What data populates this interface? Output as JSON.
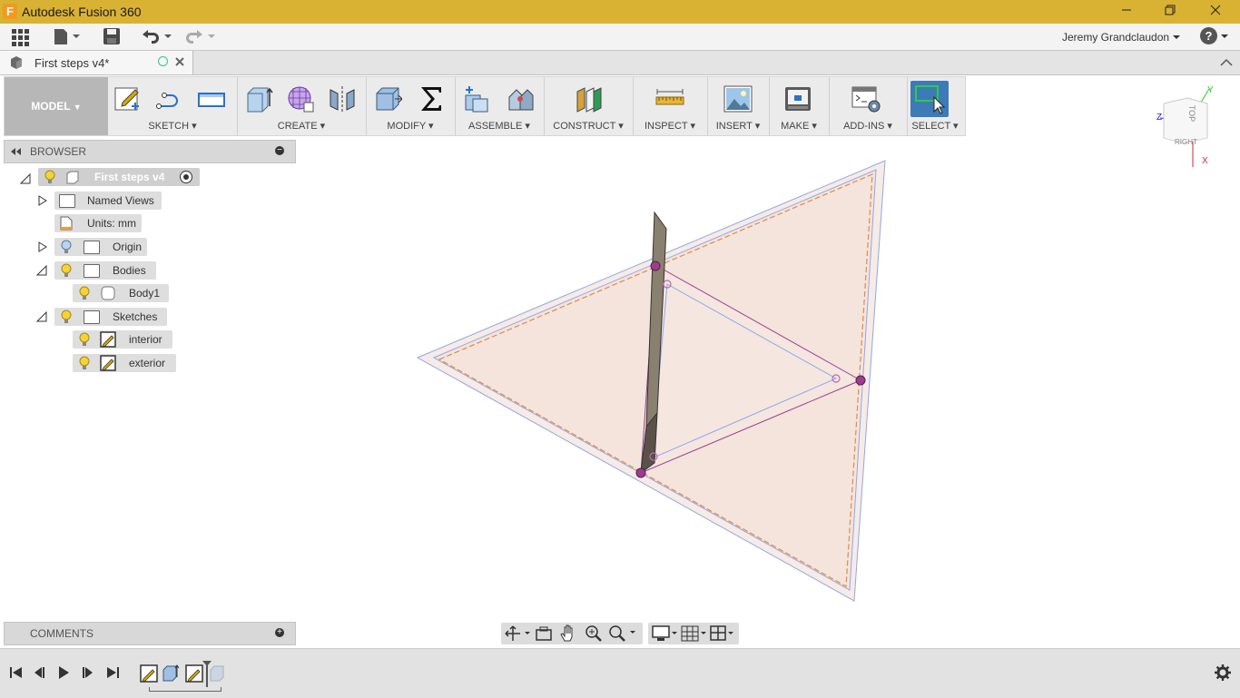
{
  "titlebar": {
    "app_title": "Autodesk Fusion 360",
    "app_icon_letter": "F"
  },
  "menubar": {
    "user_name": "Jeremy Grandclaudon",
    "help_glyph": "?"
  },
  "document_tab": {
    "title": "First steps v4*"
  },
  "toolbar": {
    "model_label": "MODEL",
    "groups": [
      {
        "label": "SKETCH"
      },
      {
        "label": "CREATE"
      },
      {
        "label": "MODIFY"
      },
      {
        "label": "ASSEMBLE"
      },
      {
        "label": "CONSTRUCT"
      },
      {
        "label": "INSPECT"
      },
      {
        "label": "INSERT"
      },
      {
        "label": "MAKE"
      },
      {
        "label": "ADD-INS"
      },
      {
        "label": "SELECT"
      }
    ]
  },
  "browser": {
    "header": "BROWSER",
    "root": "First steps v4",
    "items": {
      "named_views": "Named Views",
      "units": "Units: mm",
      "origin": "Origin",
      "bodies": "Bodies",
      "body1": "Body1",
      "sketches": "Sketches",
      "interior": "interior",
      "exterior": "exterior"
    }
  },
  "comments": {
    "header": "COMMENTS"
  },
  "viewcube": {
    "top": "TOP",
    "right": "RIGHT",
    "axis_y": "Y",
    "axis_z": "Z",
    "axis_x": "X"
  },
  "colors": {
    "titlebar": "#d9b233",
    "select_active": "#3d7ab8",
    "sketch_profile": "#f5e6df",
    "sketch_line": "#8fa8e8",
    "constraint": "#9b3e8e"
  }
}
